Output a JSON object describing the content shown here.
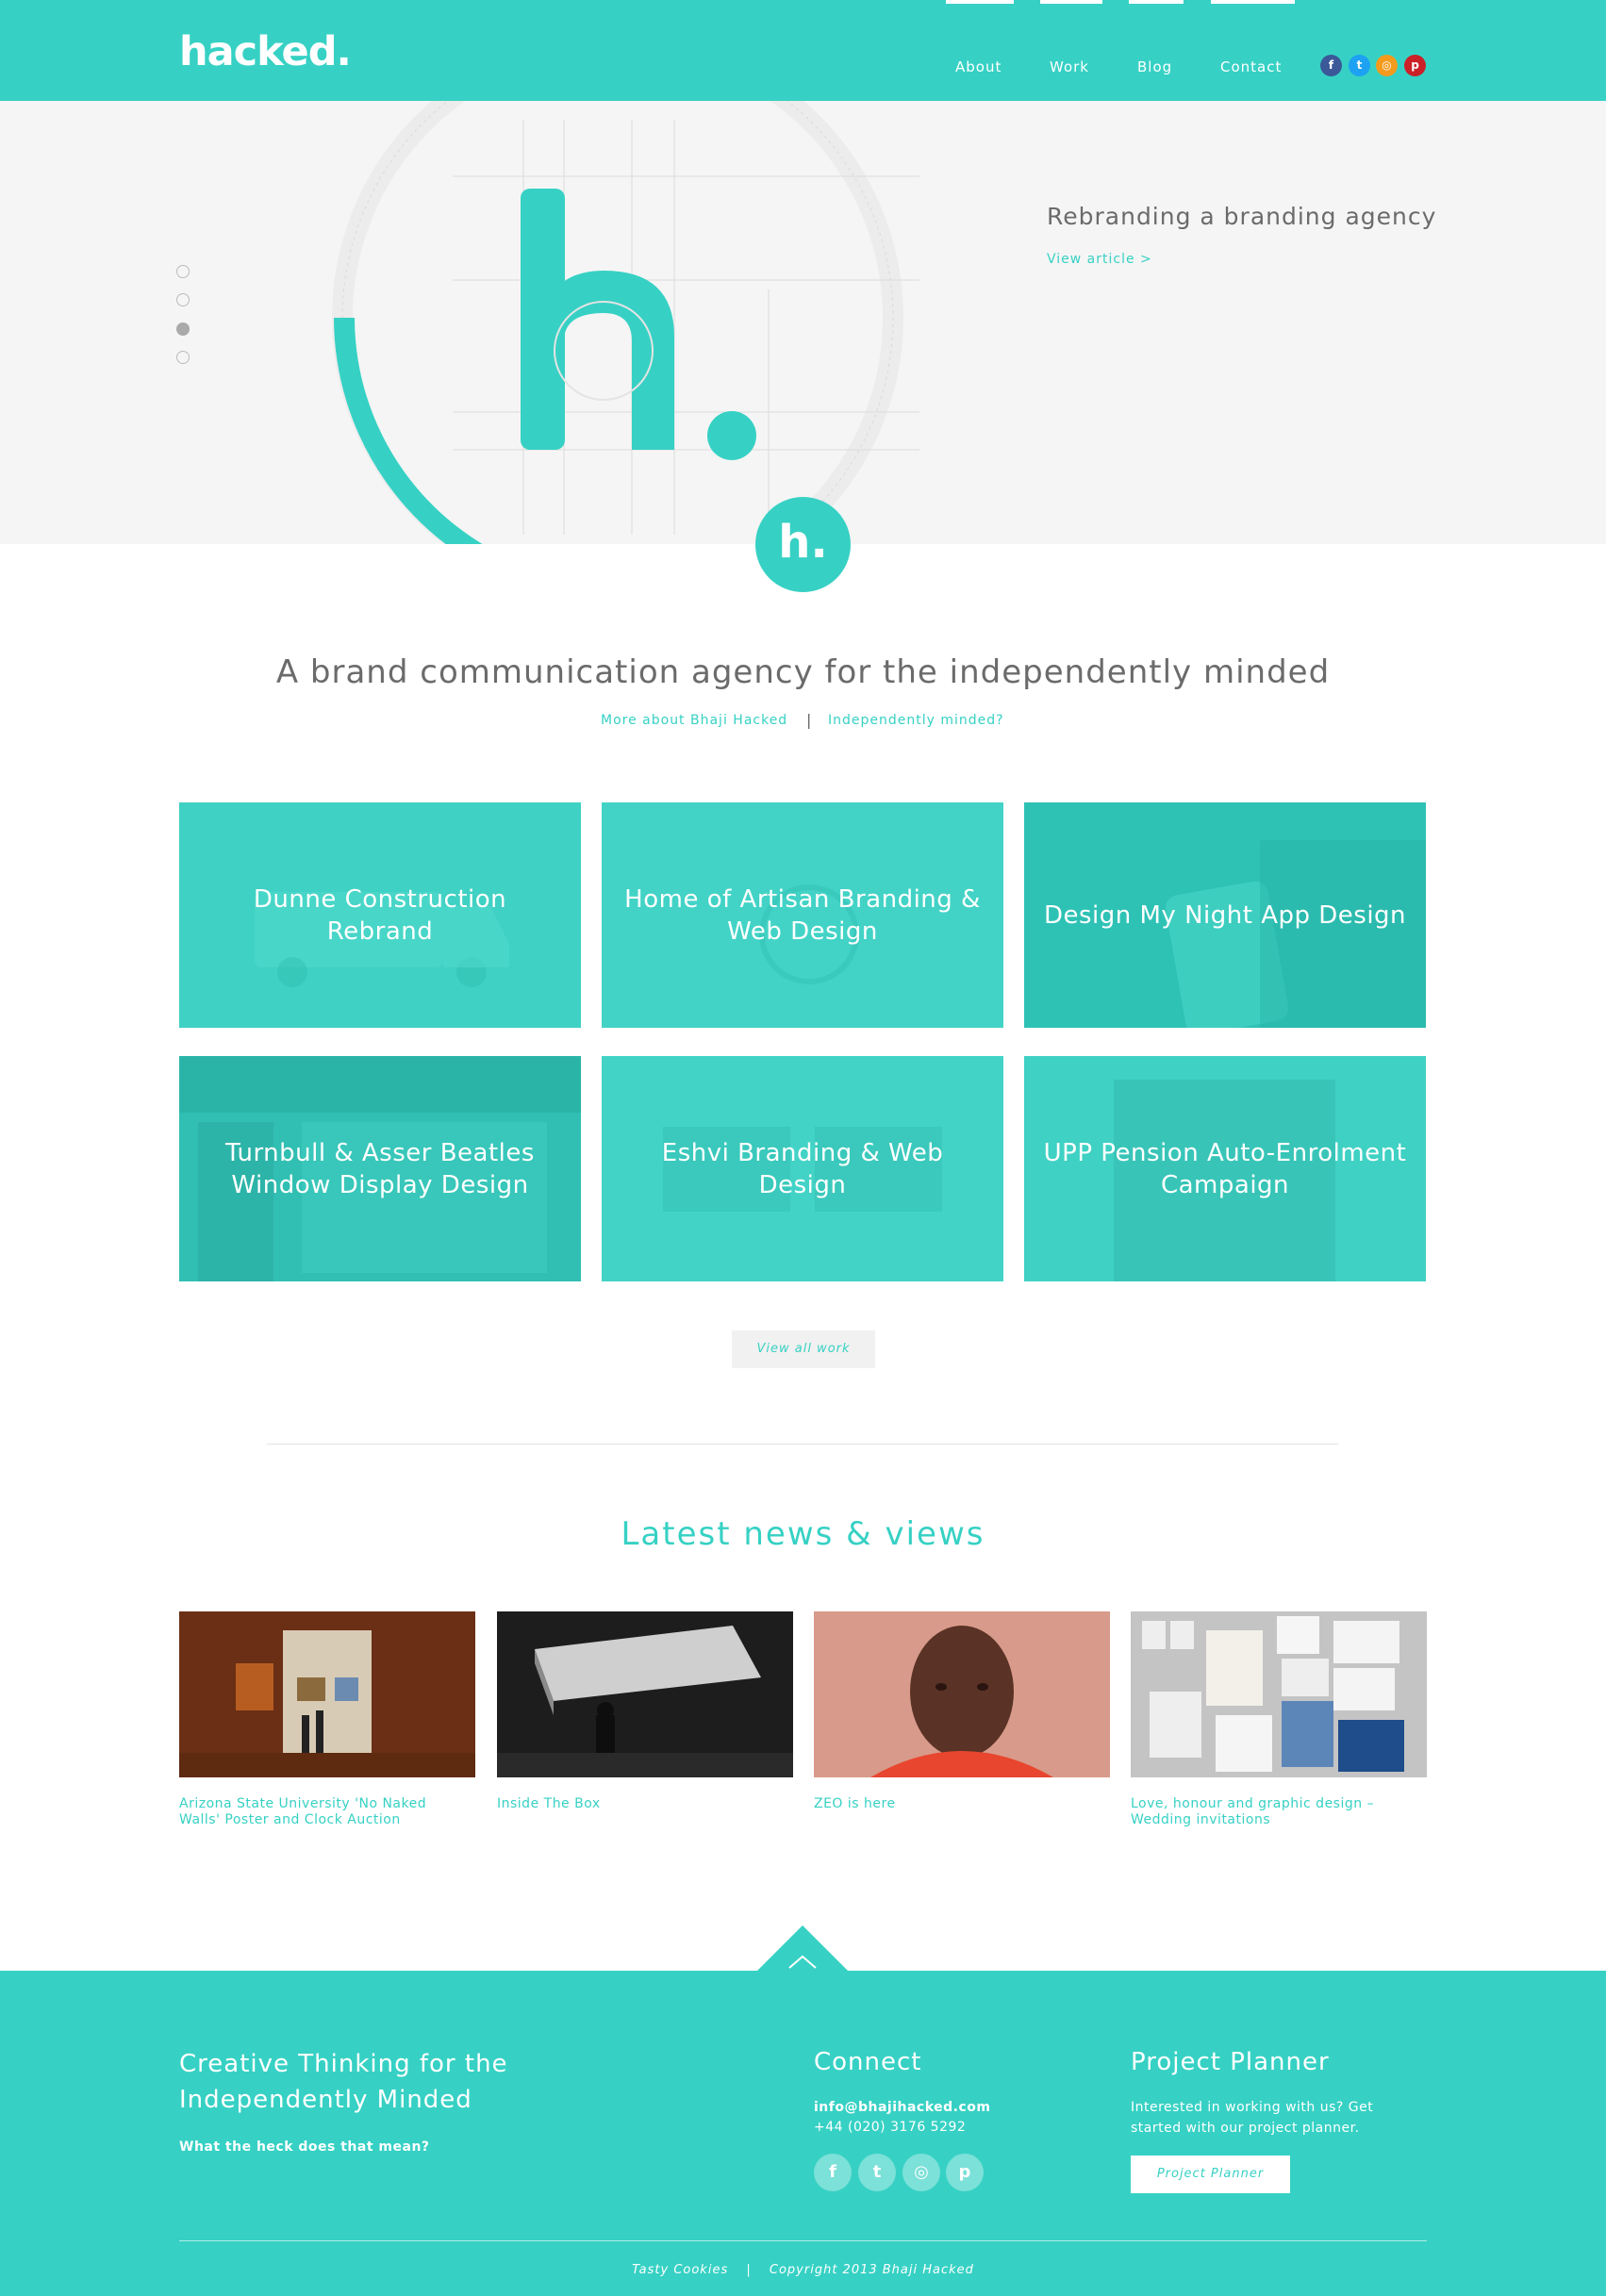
{
  "header": {
    "logo": "hacked.",
    "nav": [
      "About",
      "Work",
      "Blog",
      "Contact"
    ],
    "social": [
      {
        "icon": "facebook-icon",
        "glyph": "f",
        "color": "#3b5998"
      },
      {
        "icon": "twitter-icon",
        "glyph": "t",
        "color": "#1da1f2"
      },
      {
        "icon": "rss-icon",
        "glyph": "◎",
        "color": "#f49b1d"
      },
      {
        "icon": "pinterest-icon",
        "glyph": "p",
        "color": "#cb2027"
      }
    ]
  },
  "hero": {
    "title": "Rebranding a branding agency",
    "link": "View article >",
    "slides": 4,
    "active_slide": 3
  },
  "badge": "h.",
  "intro": {
    "tagline": "A brand communication agency for the independently minded",
    "link_more": "More about Bhaji Hacked",
    "separator": "|",
    "link_independent": "Independently minded?"
  },
  "work": {
    "items": [
      "Dunne Construction Rebrand",
      "Home of Artisan Branding & Web Design",
      "Design My Night App Design",
      "Turnbull & Asser Beatles Window Display Design",
      "Eshvi Branding & Web Design",
      "UPP Pension Auto-Enrolment Campaign"
    ],
    "view_all": "View all work"
  },
  "news": {
    "heading": "Latest news & views",
    "items": [
      "Arizona State University 'No Naked Walls' Poster and Clock Auction",
      "Inside The Box",
      "ZEO is here",
      "Love, honour and graphic design – Wedding invitations"
    ]
  },
  "footer": {
    "tagline": "Creative Thinking for the Independently Minded",
    "tagline_link": "What the heck does that mean?",
    "connect": {
      "heading": "Connect",
      "email": "info@bhajihacked.com",
      "phone": "+44 (020) 3176 5292"
    },
    "planner": {
      "heading": "Project Planner",
      "text": "Interested in working with us? Get started with our project planner.",
      "button": "Project Planner"
    },
    "cookies": "Tasty Cookies",
    "sep": "|",
    "copyright": "Copyright 2013 Bhaji Hacked"
  },
  "colors": {
    "accent": "#36d1c4",
    "hero_bg": "#f5f5f5"
  }
}
